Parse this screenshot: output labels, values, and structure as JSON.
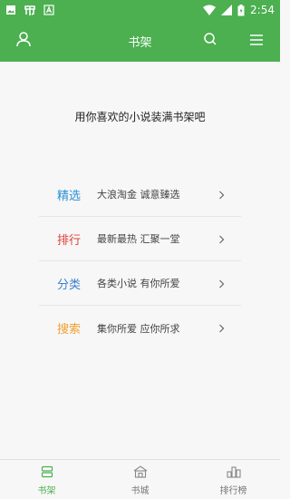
{
  "status_bar": {
    "time": "2:54",
    "icons": [
      "image-icon",
      "app-icon",
      "a-icon",
      "wifi-icon",
      "signal-icon",
      "battery-icon"
    ]
  },
  "header": {
    "title": "书架",
    "left_icon": "user-icon",
    "right_icons": [
      "search-icon",
      "menu-icon"
    ],
    "color": "#4caf50"
  },
  "main": {
    "tagline": "用你喜欢的小说装满书架吧",
    "rows": [
      {
        "title": "精选",
        "desc": "大浪淘金  诚意臻选",
        "color": "#2b8fd6"
      },
      {
        "title": "排行",
        "desc": "最新最热  汇聚一堂",
        "color": "#e0403a"
      },
      {
        "title": "分类",
        "desc": "各类小说  有你所爱",
        "color": "#3f7fcf"
      },
      {
        "title": "搜索",
        "desc": "集你所爱  应你所求",
        "color": "#f0a030"
      }
    ]
  },
  "bottom_nav": {
    "items": [
      {
        "label": "书架",
        "icon": "bookshelf-icon",
        "active": true
      },
      {
        "label": "书城",
        "icon": "bookstore-icon",
        "active": false
      },
      {
        "label": "排行榜",
        "icon": "ranking-icon",
        "active": false
      }
    ]
  }
}
